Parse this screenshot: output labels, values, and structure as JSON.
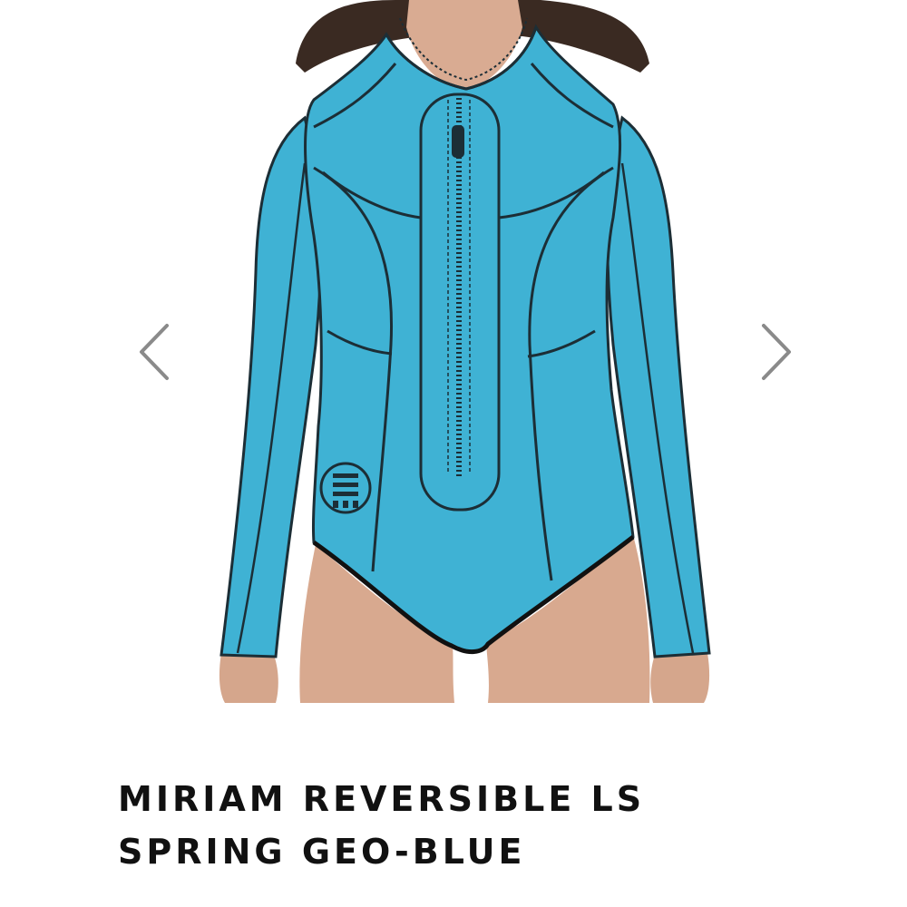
{
  "product": {
    "title_line_1": "MIRIAM REVERSIBLE LS",
    "title_line_2": "SPRING GEO-BLUE",
    "image_alt": "Woman wearing blue long sleeve spring wetsuit with front zip"
  },
  "gallery": {
    "prev_icon": "chevron-left-icon",
    "next_icon": "chevron-right-icon"
  },
  "colors": {
    "suit_blue": "#3fb2d4",
    "seam": "#1c2e36",
    "skin": "#d9ab92",
    "hair": "#3a2a22",
    "arrow": "#8a8a8a",
    "title": "#111111"
  }
}
